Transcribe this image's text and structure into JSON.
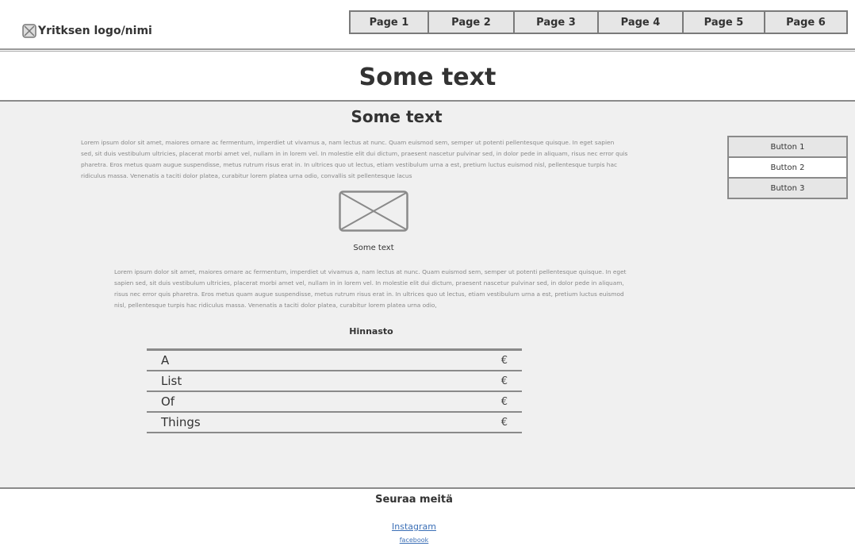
{
  "header": {
    "logo_text": "Yritksen logo/nimi",
    "nav": [
      "Page 1",
      "Page 2",
      "Page 3",
      "Page 4",
      "Page 5",
      "Page 6"
    ]
  },
  "main": {
    "title": "Some text",
    "subtitle": "Some text",
    "paragraph1": "Lorem ipsum dolor sit amet, maiores ornare ac fermentum, imperdiet ut vivamus a, nam lectus at nunc. Quam euismod sem, semper ut potenti pellentesque quisque. In eget sapien sed, sit duis vestibulum ultricies, placerat morbi amet vel, nullam in in lorem vel. In molestie elit dui dictum, praesent nascetur pulvinar sed, in dolor pede in aliquam, risus nec error quis pharetra. Eros metus quam augue suspendisse, metus rutrum risus erat in.  In ultrices quo ut lectus, etiam vestibulum urna a est, pretium luctus euismod nisl, pellentesque turpis hac ridiculus massa. Venenatis a taciti dolor platea, curabitur lorem platea urna odio, convallis sit pellentesque lacus",
    "image_caption": "Some text",
    "paragraph2": "Lorem ipsum dolor sit amet, maiores ornare ac fermentum, imperdiet ut vivamus a, nam lectus at nunc. Quam euismod sem, semper ut potenti pellentesque quisque. In eget sapien sed, sit duis vestibulum ultricies, placerat morbi amet vel, nullam in in lorem vel. In molestie elit dui dictum, praesent nascetur pulvinar sed, in dolor pede in aliquam, risus nec error quis pharetra. Eros metus quam augue suspendisse, metus rutrum risus erat in.  In ultrices quo ut lectus, etiam vestibulum urna a est, pretium luctus euismod nisl, pellentesque turpis hac ridiculus massa. Venenatis a taciti dolor platea, curabitur lorem platea urna odio,",
    "price_title": "Hinnasto",
    "price_items": [
      {
        "name": "A",
        "price": "€"
      },
      {
        "name": "List",
        "price": "€"
      },
      {
        "name": "Of",
        "price": "€"
      },
      {
        "name": "Things",
        "price": "€"
      }
    ]
  },
  "side_buttons": [
    "Button 1",
    "Button 2",
    "Button 3"
  ],
  "footer": {
    "follow": "Seuraa meitä",
    "instagram": "Instagram",
    "facebook": "facebook"
  },
  "colors": {
    "link": "#3b6fb6",
    "content_bg": "#f0f0f0",
    "button_bg": "#e6e6e6",
    "border": "#8a8a8a"
  }
}
